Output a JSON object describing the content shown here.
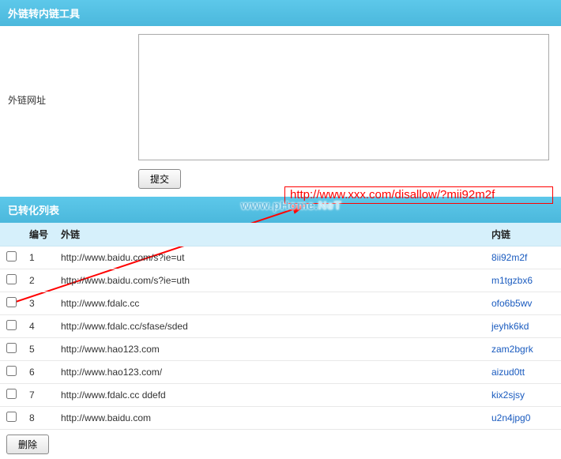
{
  "panel1": {
    "title": "外链转内链工具"
  },
  "form": {
    "label": "外链网址",
    "textarea_value": "",
    "submit_label": "提交"
  },
  "annotation": {
    "text": "http://www.xxx.com/disallow/?mii92m2f"
  },
  "watermark": {
    "part1": "www.pHome.",
    "part2": "NeT"
  },
  "panel2": {
    "title": "已转化列表"
  },
  "table": {
    "headers": {
      "num": "编号",
      "external": "外链",
      "internal": "内链"
    },
    "rows": [
      {
        "num": "1",
        "external": "http://www.baidu.com/s?ie=ut",
        "internal": "8ii92m2f"
      },
      {
        "num": "2",
        "external": "http://www.baidu.com/s?ie=uth",
        "internal": "m1tgzbx6"
      },
      {
        "num": "3",
        "external": "http://www.fdalc.cc",
        "internal": "ofo6b5wv"
      },
      {
        "num": "4",
        "external": "http://www.fdalc.cc/sfase/sded",
        "internal": "jeyhk6kd"
      },
      {
        "num": "5",
        "external": "http://www.hao123.com",
        "internal": "zam2bgrk"
      },
      {
        "num": "6",
        "external": "http://www.hao123.com/",
        "internal": "aizud0tt"
      },
      {
        "num": "7",
        "external": "http://www.fdalc.cc ddefd",
        "internal": "kix2sjsy"
      },
      {
        "num": "8",
        "external": "http://www.baidu.com",
        "internal": "u2n4jpg0"
      }
    ]
  },
  "delete_label": "删除"
}
